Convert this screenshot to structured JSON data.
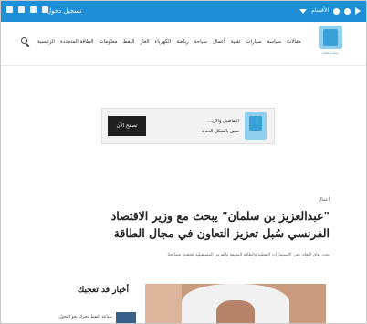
{
  "topbar": {
    "login_label": "تسجيل دخول",
    "section_select": "الأقسام",
    "social_icons": [
      "instagram-icon",
      "youtube-icon",
      "twitter-icon",
      "facebook-icon",
      "rss-icon"
    ],
    "color": "#1e8fd6"
  },
  "header": {
    "logo_subtitle": "مجلة الطاقة",
    "nav": [
      "الرئيسية",
      "الطاقة المتجددة",
      "معلومات",
      "النفط",
      "الغاز",
      "الكهرباء",
      "رياضة",
      "سياحة",
      "أعمال",
      "تقنية",
      "سيارات",
      "سياسة",
      "مقالات"
    ]
  },
  "ad": {
    "line1": "التفاصيل والآن…",
    "line2": "سيق بالشكل الجديد",
    "cta": "تصفح الآن"
  },
  "article": {
    "category": "أعمال",
    "headline": "\"عبدالعزيز بن سلمان\" يبحث مع وزير الاقتصاد الفرنسي سُبل تعزيز التعاون في مجال الطاقة",
    "summary": "بحث آفاق التعاون في الاستثمارات النفطية والطاقة النظيفة والفرص المستقبلية لتحقيق مصالحنا"
  },
  "sidebar": {
    "title": "أخبار قد تعجبك",
    "items": [
      {
        "text": "صناعة النفط تتحرك نحو التحول"
      }
    ]
  }
}
